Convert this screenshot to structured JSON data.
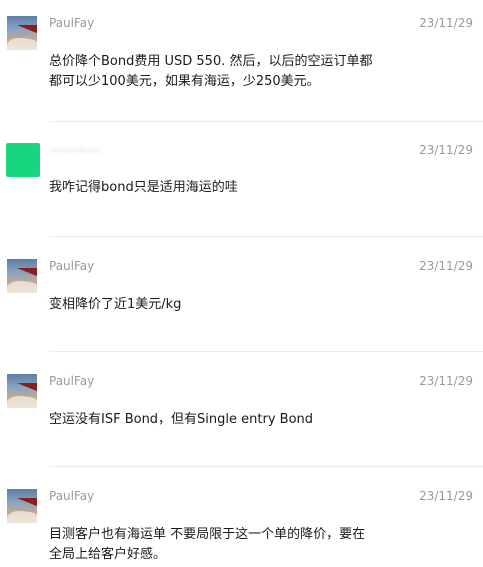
{
  "messages": [
    {
      "sender": "PaulFay",
      "avatar": "airplane-wing-avatar",
      "time": "23/11/29",
      "text": "总价降个Bond费用 USD 550. 然后，以后的空运订单都\n都可以少100美元，如果有海运，少250美元。"
    },
    {
      "sender": "————",
      "avatar": "green-avatar",
      "time": "23/11/29",
      "text": "我咋记得bond只是适用海运的哇"
    },
    {
      "sender": "PaulFay",
      "avatar": "airplane-wing-avatar",
      "time": "23/11/29",
      "text": "变相降价了近1美元/kg"
    },
    {
      "sender": "PaulFay",
      "avatar": "airplane-wing-avatar",
      "time": "23/11/29",
      "text": "空运没有ISF Bond，但有Single entry Bond"
    },
    {
      "sender": "PaulFay",
      "avatar": "airplane-wing-avatar",
      "time": "23/11/29",
      "text": "目测客户也有海运单 不要局限于这一个单的降价，要在\n全局上给客户好感。"
    }
  ],
  "colors": {
    "background": "#ffffff",
    "meta_text": "#9a9a9a",
    "body_text": "#1a1a1a",
    "divider": "#ececec",
    "green_avatar": "#19d57f"
  }
}
